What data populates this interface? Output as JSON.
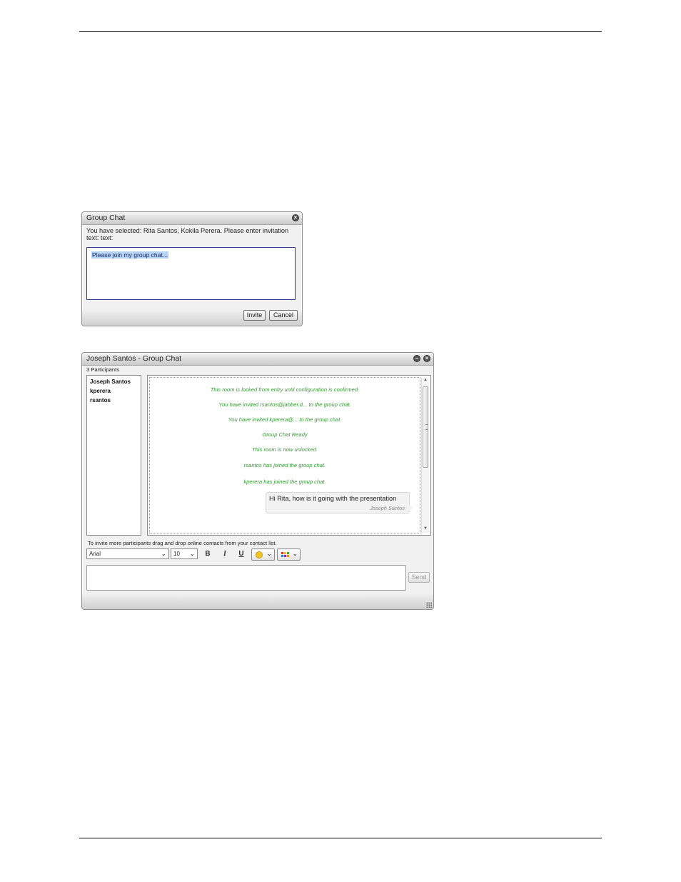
{
  "invite_dialog": {
    "title": "Group Chat",
    "prompt": "You have selected: Rita Santos, Kokila Perera. Please enter invitation text: text:",
    "message_value": "Please join my group chat...",
    "invite_label": "Invite",
    "cancel_label": "Cancel"
  },
  "chat_window": {
    "title": "Joseph Santos - Group Chat",
    "participant_count": "3 Participants",
    "participants": [
      "Joseph Santos",
      "kperera",
      "rsantos"
    ],
    "system_messages": [
      "This room is locked from entry until configuration is confirmed.",
      "You have invited rsantos@jabber.d... to the group chat.",
      "You have invited kperera@... to the group chat.",
      "Group Chat Ready",
      "This room is now unlocked.",
      "rsantos has joined the group chat.",
      "kperera has joined the group chat."
    ],
    "chat_message": {
      "text": "Hi Rita, how is it going with the presentation",
      "sender": "Joseph Santos"
    },
    "hint": "To invite more participants drag and drop online contacts from your contact list.",
    "font_value": "Arial",
    "font_size_value": "10",
    "bold_label": "B",
    "italic_label": "I",
    "underline_label": "U",
    "send_label": "Send"
  },
  "icons": {
    "minimize": "minimize-icon",
    "close": "close-icon",
    "emoji": "smiley-icon",
    "color": "color-palette-icon"
  },
  "colors": {
    "system_message": "#2e9a2e",
    "selection": "#b5d4f5",
    "input_border": "#2b3a8f"
  }
}
